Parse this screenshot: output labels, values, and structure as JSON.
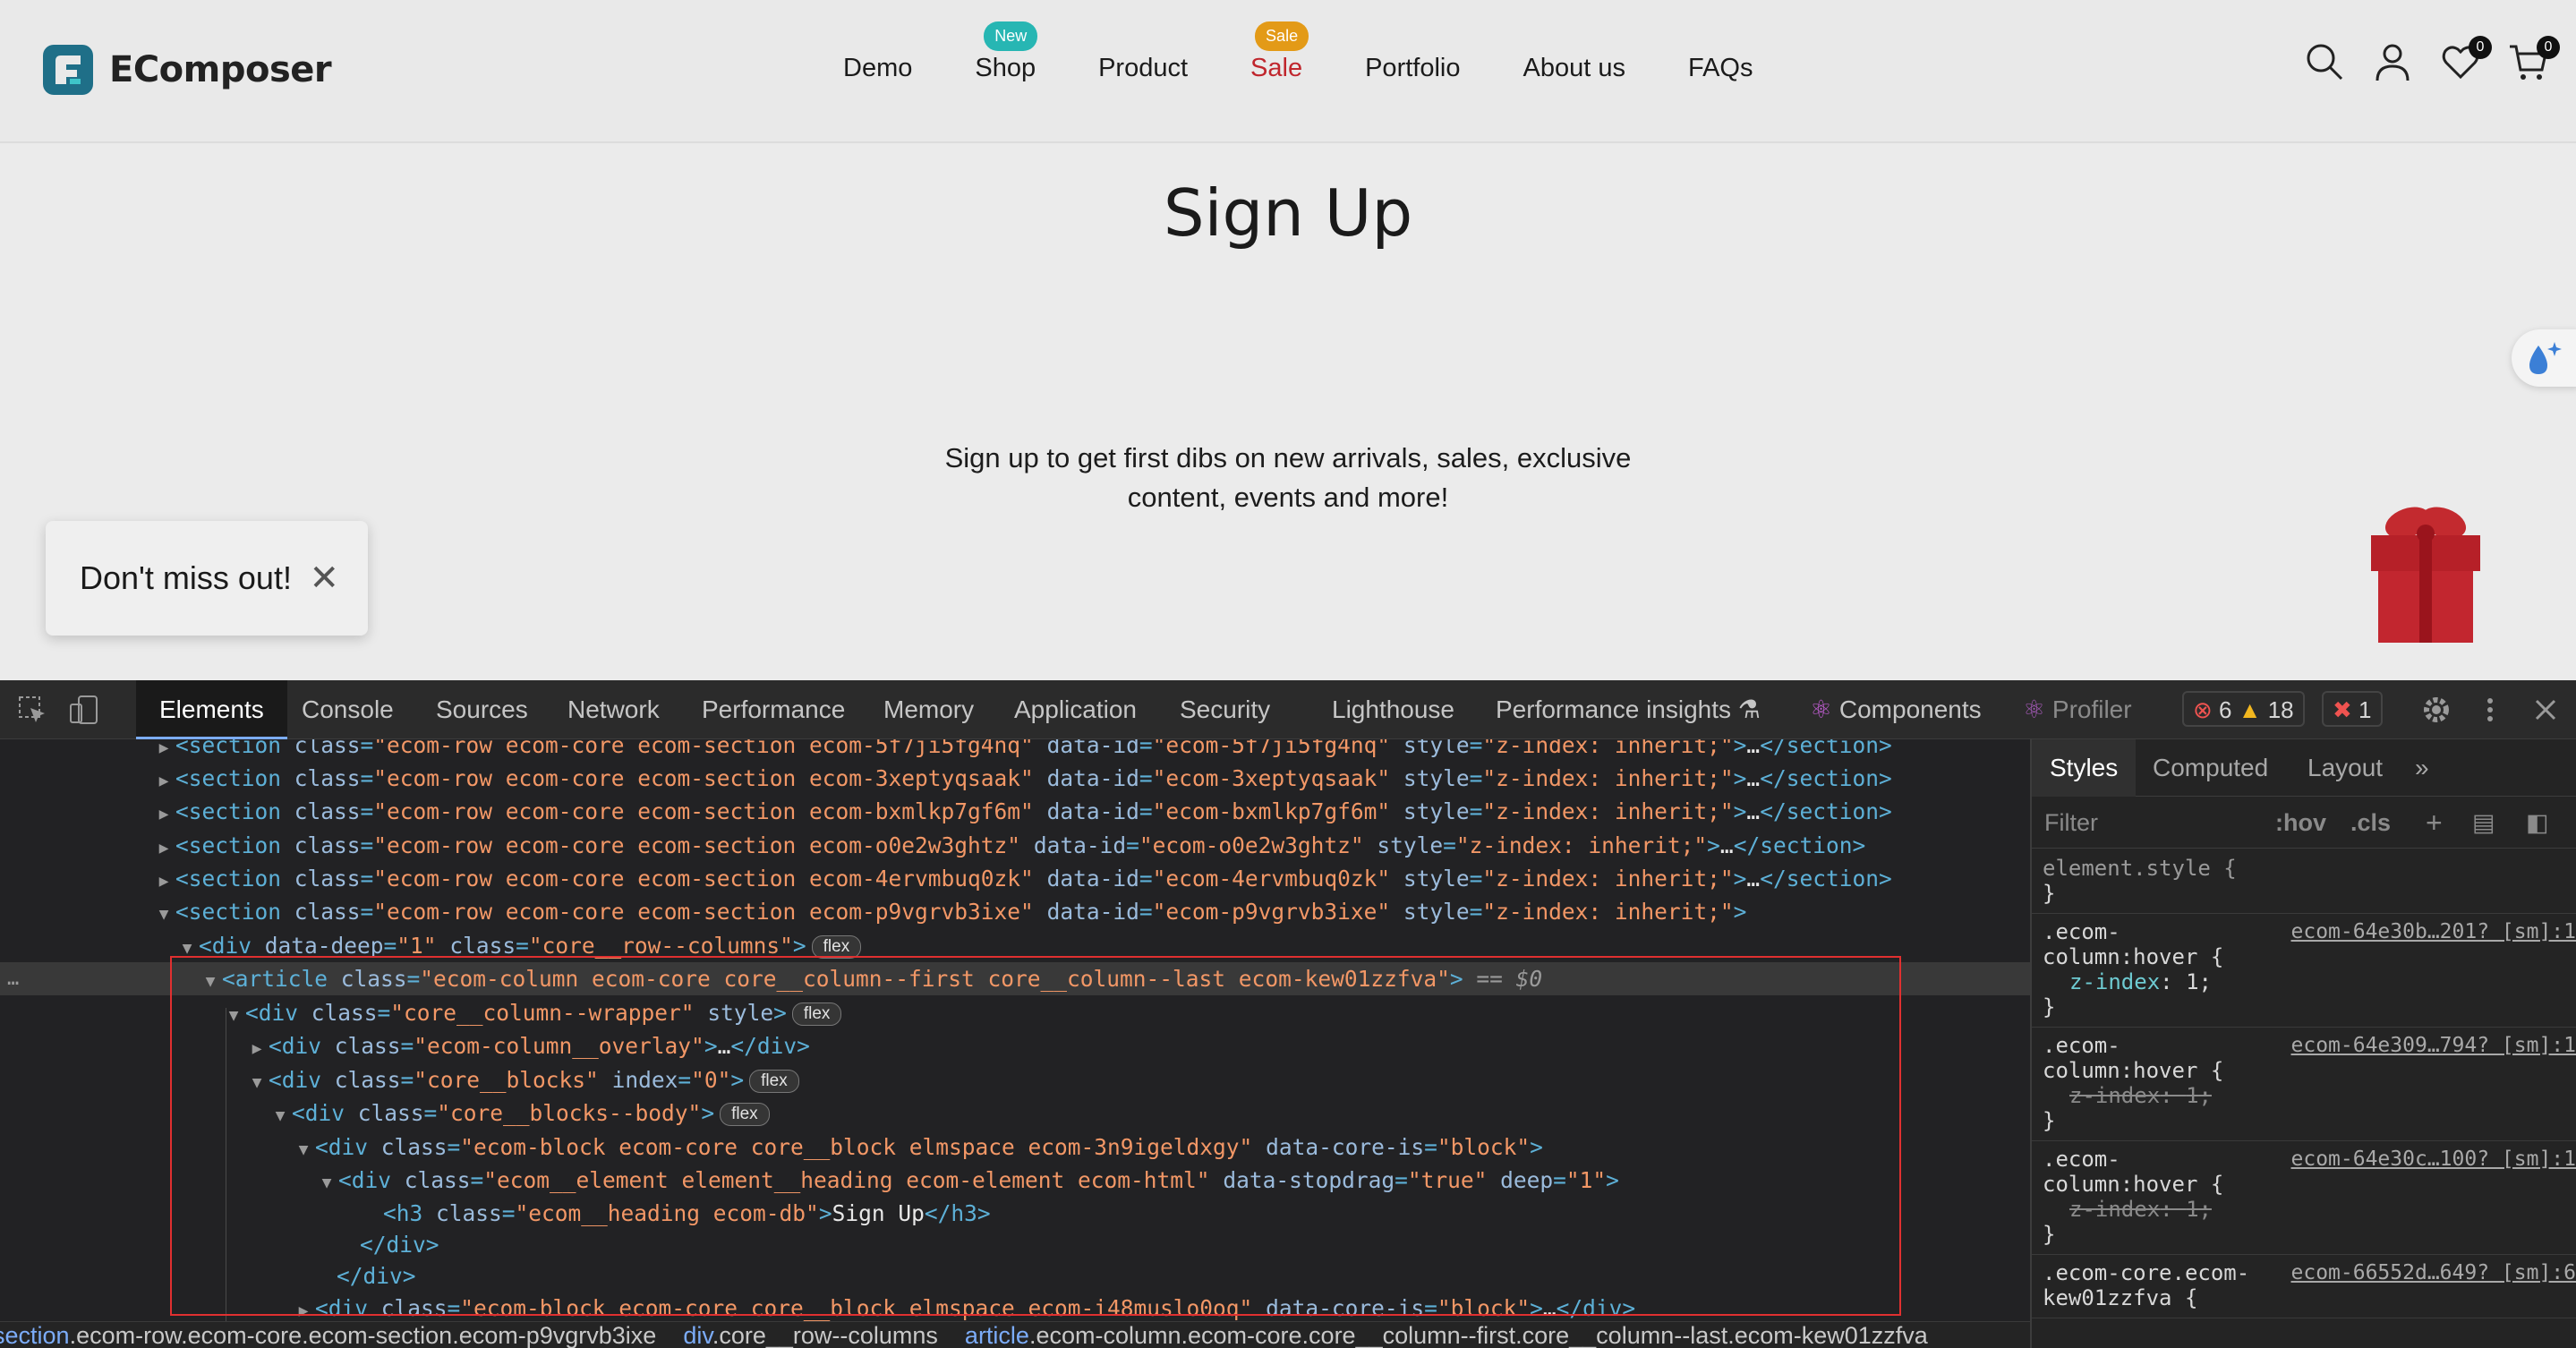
{
  "site": {
    "logo_text": "EComposer",
    "nav": [
      {
        "label": "Demo",
        "badge": ""
      },
      {
        "label": "Shop",
        "badge": "New"
      },
      {
        "label": "Product",
        "badge": ""
      },
      {
        "label": "Sale",
        "badge": "Sale"
      },
      {
        "label": "Portfolio",
        "badge": ""
      },
      {
        "label": "About us",
        "badge": ""
      },
      {
        "label": "FAQs",
        "badge": ""
      }
    ],
    "wishlist_count": "0",
    "cart_count": "0",
    "page_title": "Sign Up",
    "page_subtitle": "Sign up to get first dibs on new arrivals, sales, exclusive content, events and more!",
    "popup_text": "Don't miss out!",
    "popup_close": "✕",
    "colors": {
      "sale": "#c0262d",
      "badge_new": "#27b6b3",
      "badge_sale": "#e39a17",
      "logo": "#1f6f88"
    }
  },
  "devtools": {
    "tabs": [
      "Elements",
      "Console",
      "Sources",
      "Network",
      "Performance",
      "Memory",
      "Application",
      "Security",
      "Lighthouse",
      "Performance insights",
      "Components",
      "Profiler"
    ],
    "errors": "6",
    "warnings": "18",
    "issues": "1",
    "style_tabs": [
      "Styles",
      "Computed",
      "Layout",
      "»"
    ],
    "filter_placeholder": "Filter",
    "hov": ":hov",
    "cls": ".cls",
    "selected_marker": "== $0",
    "flex_label": "flex",
    "dom_lines": [
      "<section class=\"ecom-row ecom-core ecom-section ecom-5f7ji5fg4nq\" data-id=\"ecom-5f7ji5fg4nq\" style=\"z-index: inherit;\">…</section>",
      "<section class=\"ecom-row ecom-core ecom-section ecom-3xeptyqsaak\" data-id=\"ecom-3xeptyqsaak\" style=\"z-index: inherit;\">…</section>",
      "<section class=\"ecom-row ecom-core ecom-section ecom-bxmlkp7gf6m\" data-id=\"ecom-bxmlkp7gf6m\" style=\"z-index: inherit;\">…</section>",
      "<section class=\"ecom-row ecom-core ecom-section ecom-o0e2w3ghtz\" data-id=\"ecom-o0e2w3ghtz\" style=\"z-index: inherit;\">…</section>",
      "<section class=\"ecom-row ecom-core ecom-section ecom-4ervmbuq0zk\" data-id=\"ecom-4ervmbuq0zk\" style=\"z-index: inherit;\">…</section>",
      "<section class=\"ecom-row ecom-core ecom-section ecom-p9vgrvb3ixe\" data-id=\"ecom-p9vgrvb3ixe\" style=\"z-index: inherit;\">",
      "<div data-deep=\"1\" class=\"core__row--columns\">",
      "<article class=\"ecom-column ecom-core core__column--first core__column--last ecom-kew01zzfva\">",
      "<div class=\"core__column--wrapper\" style>",
      "<div class=\"ecom-column__overlay\">…</div>",
      "<div class=\"core__blocks\" index=\"0\">",
      "<div class=\"core__blocks--body\">",
      "<div class=\"ecom-block ecom-core core__block elmspace ecom-3n9igeldxgy\" data-core-is=\"block\">",
      "<div class=\"ecom__element element__heading ecom-element ecom-html\" data-stopdrag=\"true\" deep=\"1\">",
      "<h3 class=\"ecom__heading ecom-db\">Sign Up</h3>",
      "</div>",
      "</div>",
      "<div class=\"ecom-block ecom-core core__block elmspace ecom-i48muslo0oq\" data-core-is=\"block\">…</div>"
    ],
    "breadcrumb": [
      {
        "tag": "section",
        "rest": ".ecom-row.ecom-core.ecom-section.ecom-p9vgrvb3ixe"
      },
      {
        "tag": "div",
        "rest": ".core__row--columns"
      },
      {
        "tag": "article",
        "rest": ".ecom-column.ecom-core.core__column--first.core__column--last.ecom-kew01zzfva"
      }
    ],
    "style_rules": [
      {
        "selector": "element.style {",
        "source": "",
        "prop": "",
        "value": "",
        "struck": false
      },
      {
        "selector": ".ecom-column:hover {",
        "source": "ecom-64e30b…201? [sm]:1",
        "prop": "z-index",
        "value": "1",
        "struck": false
      },
      {
        "selector": ".ecom-column:hover {",
        "source": "ecom-64e309…794? [sm]:1",
        "prop": "z-index",
        "value": "1",
        "struck": true
      },
      {
        "selector": ".ecom-column:hover {",
        "source": "ecom-64e30c…100? [sm]:1",
        "prop": "z-index",
        "value": "1",
        "struck": true
      },
      {
        "selector": ".ecom-core.ecom-kew01zzfva {",
        "source": "ecom-66552d…649? [sm]:6",
        "prop": "",
        "value": "",
        "struck": false
      }
    ]
  }
}
